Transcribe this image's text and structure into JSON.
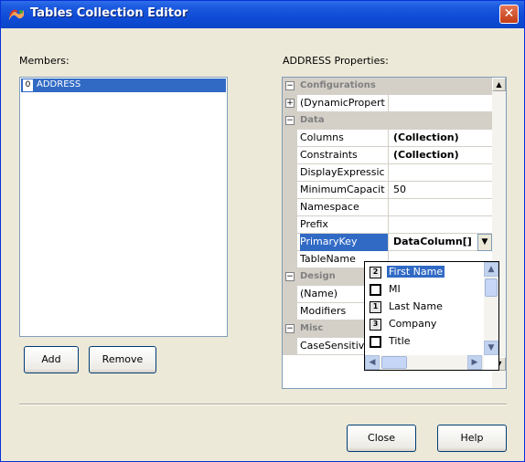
{
  "window": {
    "title": "Tables Collection Editor",
    "close_glyph": "✕"
  },
  "members": {
    "label": "Members:",
    "items": [
      {
        "index": "0",
        "name": "ADDRESS"
      }
    ]
  },
  "buttons": {
    "add": "Add",
    "remove": "Remove",
    "close": "Close",
    "help": "Help"
  },
  "properties": {
    "label": "ADDRESS Properties:",
    "categories": {
      "configurations": "Configurations",
      "data": "Data",
      "design": "Design",
      "misc": "Misc"
    },
    "rows": {
      "dynamic": {
        "name": "(DynamicPropert",
        "value": ""
      },
      "columns": {
        "name": "Columns",
        "value": "(Collection)"
      },
      "constraints": {
        "name": "Constraints",
        "value": "(Collection)"
      },
      "displayexpr": {
        "name": "DisplayExpressic",
        "value": ""
      },
      "mincap": {
        "name": "MinimumCapacit",
        "value": "50"
      },
      "namespace": {
        "name": "Namespace",
        "value": ""
      },
      "prefix": {
        "name": "Prefix",
        "value": ""
      },
      "primarykey": {
        "name": "PrimaryKey",
        "value": "DataColumn[]"
      },
      "tablename": {
        "name": "TableName",
        "value": ""
      },
      "name": {
        "name": "(Name)",
        "value": ""
      },
      "modifiers": {
        "name": "Modifiers",
        "value": ""
      },
      "casesensitive": {
        "name": "CaseSensitiv",
        "value": ""
      }
    },
    "expander_plus": "+",
    "expander_minus": "−"
  },
  "primary_key_popup": {
    "items": [
      {
        "name": "First Name",
        "order": "2",
        "selected": true
      },
      {
        "name": "MI",
        "order": "",
        "selected": false
      },
      {
        "name": "Last Name",
        "order": "1",
        "selected": false
      },
      {
        "name": "Company",
        "order": "3",
        "selected": false
      },
      {
        "name": "Title",
        "order": "",
        "selected": false
      }
    ]
  },
  "colors": {
    "titlebar": "#0a45c8",
    "selection": "#316ac5",
    "dialog_bg": "#ece9d8",
    "close_red": "#c23b16"
  },
  "icons": {
    "title": "app-icon",
    "close": "close-icon",
    "dropdown": "chevron-down-icon",
    "scroll_up": "scroll-up-icon",
    "scroll_down": "scroll-down-icon",
    "scroll_left": "scroll-left-icon",
    "scroll_right": "scroll-right-icon"
  }
}
